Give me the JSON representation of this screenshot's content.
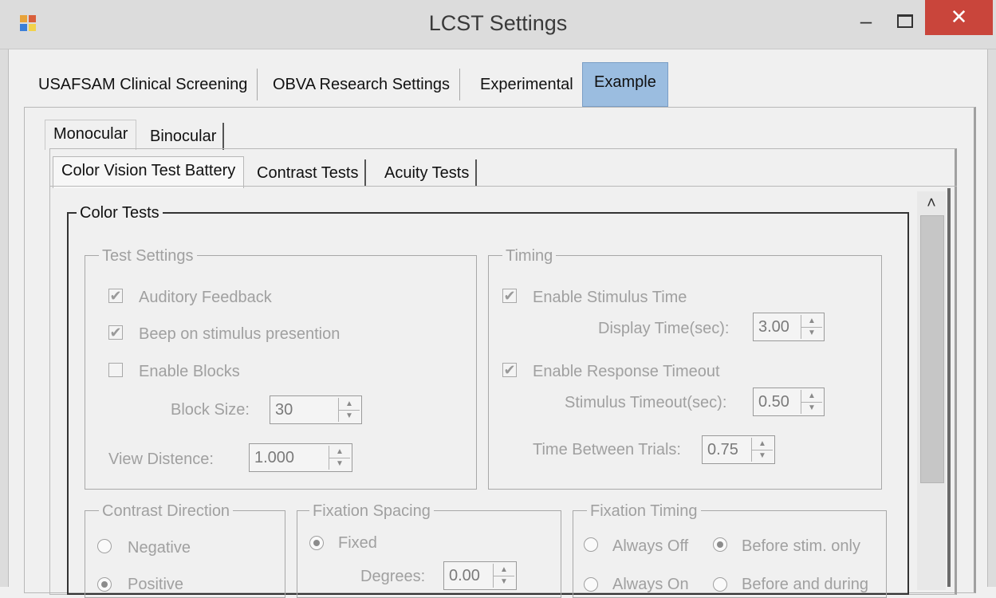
{
  "window": {
    "title": "LCST Settings",
    "minimize": "–",
    "close": "✕"
  },
  "tabs_top": [
    "USAFSAM Clinical Screening",
    "OBVA Research Settings",
    "Experimental",
    "Example"
  ],
  "tabs_eye": [
    "Monocular",
    "Binocular"
  ],
  "tabs_test": [
    "Color Vision Test Battery",
    "Contrast Tests",
    "Acuity Tests"
  ],
  "color_tests": {
    "title": "Color Tests",
    "test_settings": {
      "title": "Test Settings",
      "auditory_feedback": "Auditory Feedback",
      "beep": "Beep on stimulus presention",
      "enable_blocks": "Enable Blocks",
      "block_size_label": "Block Size:",
      "block_size": "30",
      "view_distance_label": "View Distence:",
      "view_distance": "1.000"
    },
    "timing": {
      "title": "Timing",
      "enable_stimulus_time": "Enable Stimulus Time",
      "display_time_label": "Display Time(sec):",
      "display_time": "3.00",
      "enable_response_timeout": "Enable Response Timeout",
      "stimulus_timeout_label": "Stimulus Timeout(sec):",
      "stimulus_timeout": "0.50",
      "time_between_label": "Time Between Trials:",
      "time_between": "0.75"
    },
    "contrast_direction": {
      "title": "Contrast Direction",
      "negative": "Negative",
      "positive": "Positive"
    },
    "fixation_spacing": {
      "title": "Fixation Spacing",
      "fixed": "Fixed",
      "degrees_label": "Degrees:",
      "degrees": "0.00"
    },
    "fixation_timing": {
      "title": "Fixation Timing",
      "always_off": "Always Off",
      "before_only": "Before stim. only",
      "always_on": "Always On",
      "before_during": "Before and during"
    }
  },
  "icons": {
    "scroll_up": "˄",
    "check": "✔",
    "spin_up": "▲",
    "spin_down": "▼"
  }
}
